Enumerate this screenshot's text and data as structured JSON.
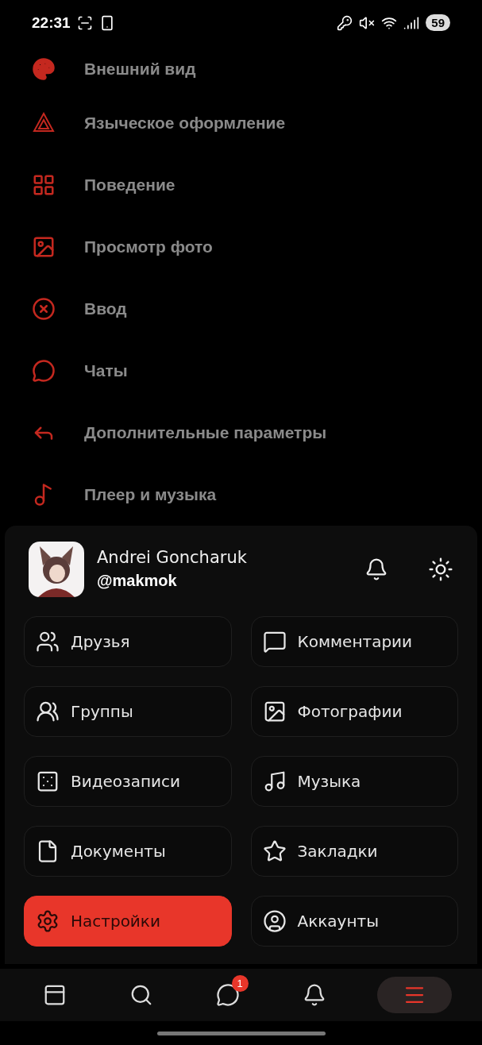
{
  "status_bar": {
    "time": "22:31",
    "battery": "59"
  },
  "settings_items": [
    {
      "label": "Внешний вид"
    },
    {
      "label": "Языческое оформление"
    },
    {
      "label": "Поведение"
    },
    {
      "label": "Просмотр фото"
    },
    {
      "label": "Ввод"
    },
    {
      "label": "Чаты"
    },
    {
      "label": "Дополнительные параметры"
    },
    {
      "label": "Плеер и музыка"
    }
  ],
  "profile": {
    "name": "Andrei Goncharuk",
    "handle": "@makmok"
  },
  "menu_tiles": [
    {
      "label": "Друзья",
      "selected": false
    },
    {
      "label": "Комментарии",
      "selected": false
    },
    {
      "label": "Группы",
      "selected": false
    },
    {
      "label": "Фотографии",
      "selected": false
    },
    {
      "label": "Видеозаписи",
      "selected": false
    },
    {
      "label": "Музыка",
      "selected": false
    },
    {
      "label": "Документы",
      "selected": false
    },
    {
      "label": "Закладки",
      "selected": false
    },
    {
      "label": "Настройки",
      "selected": true
    },
    {
      "label": "Аккаунты",
      "selected": false
    }
  ],
  "bottom_nav": [
    {
      "selected": false
    },
    {
      "selected": false
    },
    {
      "selected": false,
      "badge": "1"
    },
    {
      "selected": false
    },
    {
      "selected": true
    }
  ]
}
